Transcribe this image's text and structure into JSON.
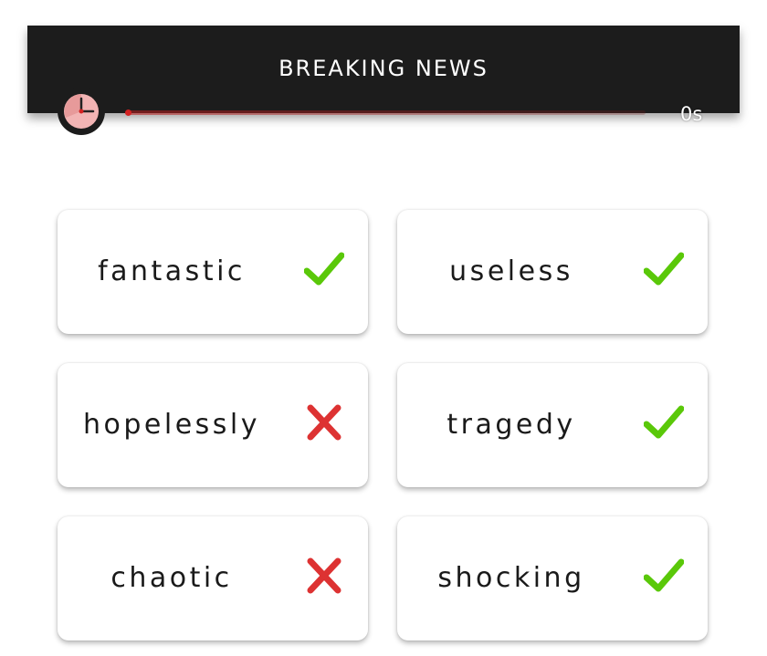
{
  "header": {
    "title": "BREAKING NEWS"
  },
  "timer": {
    "icon": "clock-icon",
    "text": "0s",
    "progress_fraction": 0
  },
  "colors": {
    "header_bg": "#1c1c1c",
    "correct": "#5ac809",
    "wrong": "#dd3232",
    "progress": "#d32222"
  },
  "cards": [
    {
      "word": "fantastic",
      "status": "correct",
      "icon": "checkmark-icon"
    },
    {
      "word": "useless",
      "status": "correct",
      "icon": "checkmark-icon"
    },
    {
      "word": "hopelessly",
      "status": "wrong",
      "icon": "cross-icon"
    },
    {
      "word": "tragedy",
      "status": "correct",
      "icon": "checkmark-icon"
    },
    {
      "word": "chaotic",
      "status": "wrong",
      "icon": "cross-icon"
    },
    {
      "word": "shocking",
      "status": "correct",
      "icon": "checkmark-icon"
    }
  ]
}
